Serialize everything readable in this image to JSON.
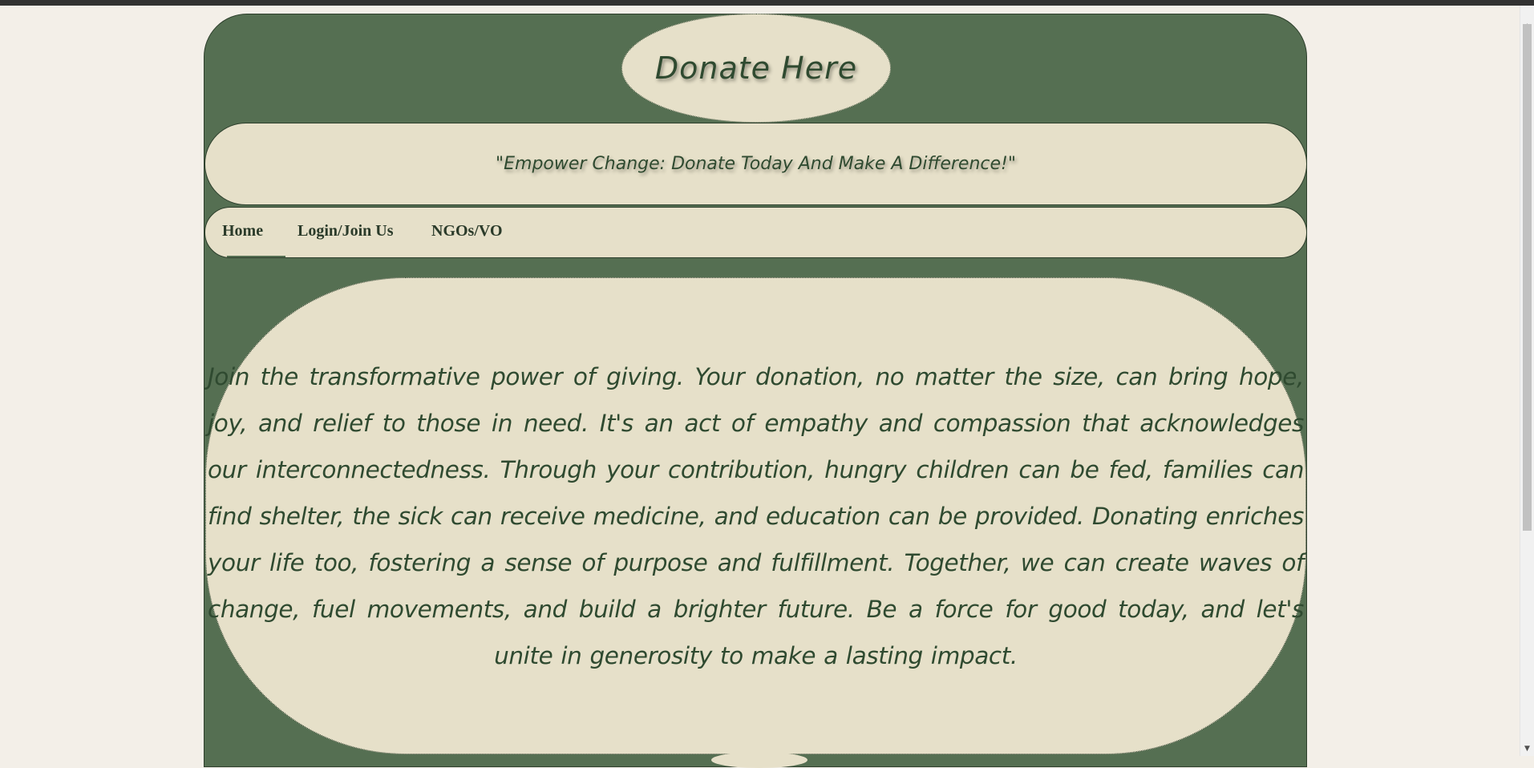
{
  "header": {
    "title": "Donate Here",
    "tagline": "\"Empower Change: Donate Today And Make A Difference!\""
  },
  "nav": {
    "items": [
      {
        "label": "Home",
        "active": true
      },
      {
        "label": "Login/Join Us",
        "active": false
      },
      {
        "label": "NGOs/VO",
        "active": false
      }
    ]
  },
  "main": {
    "body_text": "Join the transformative power of giving. Your donation, no matter the size, can bring hope, joy, and relief to those in need. It's an act of empathy and compassion that acknowledges our interconnectedness. Through your contribution, hungry children can be fed, families can find shelter, the sick can receive medicine, and education can be provided. Donating enriches your life too, fostering a sense of purpose and fulfillment. Together, we can create waves of change, fuel movements, and build a brighter future. Be a force for good today, and let's unite in generosity to make a lasting impact."
  },
  "colors": {
    "page_background": "#f3efe8",
    "frame_green": "#556f52",
    "panel_cream": "#e6e0c9",
    "text_green": "#2f4a30"
  },
  "icons": {
    "scroll_up": "triangle-up",
    "scroll_down": "triangle-down"
  }
}
